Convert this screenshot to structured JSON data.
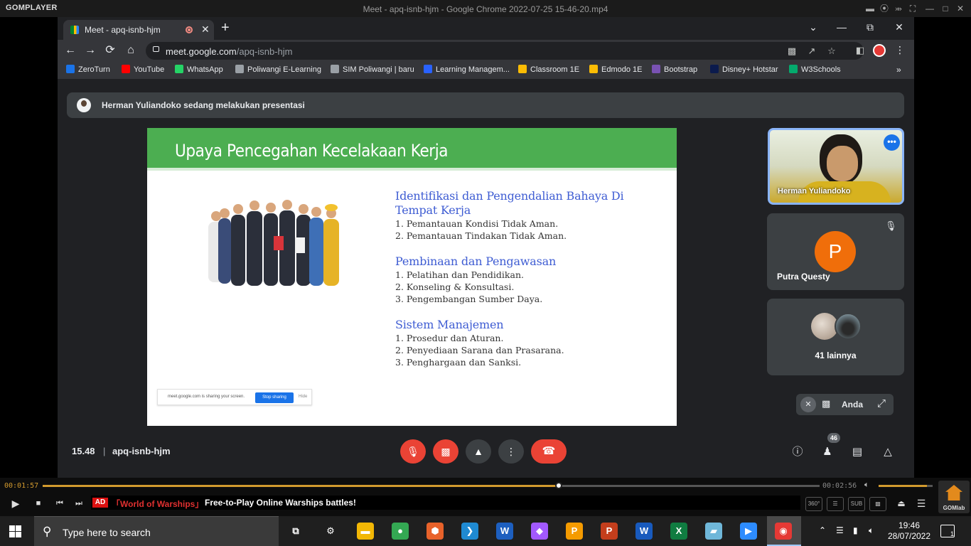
{
  "player": {
    "logo": "GOMPLAYER",
    "title": "Meet - apq-isnb-hjm - Google Chrome 2022-07-25 15-46-20.mp4",
    "time_current": "00:01:57",
    "time_total": "00:02:56",
    "progress": 0.664,
    "volume": 0.9,
    "ad_tag": "AD",
    "ad_title": "「World of Warships」",
    "ad_text": "Free-to-Play Online Warships battles!",
    "btn_360": "360°",
    "btn_sub": "SUB",
    "gomlab_label": "GOMlab"
  },
  "chrome": {
    "tab_title": "Meet - apq-isnb-hjm",
    "url_host": "meet.google.com",
    "url_path": "/apq-isnb-hjm",
    "bookmarks": [
      {
        "label": "ZeroTurn",
        "color": "#1a73e8"
      },
      {
        "label": "YouTube",
        "color": "#ff0000"
      },
      {
        "label": "WhatsApp",
        "color": "#25d366"
      },
      {
        "label": "Poliwangi E-Learning",
        "color": "#9aa0a6"
      },
      {
        "label": "SIM Poliwangi | baru",
        "color": "#9aa0a6"
      },
      {
        "label": "Learning Managem...",
        "color": "#2962ff"
      },
      {
        "label": "Classroom 1E",
        "color": "#fbbc04"
      },
      {
        "label": "Edmodo 1E",
        "color": "#fbbc04"
      },
      {
        "label": "Bootstrap",
        "color": "#7952b3"
      },
      {
        "label": "Disney+ Hotstar",
        "color": "#0b1b4d"
      },
      {
        "label": "W3Schools",
        "color": "#04aa6d"
      }
    ]
  },
  "meet": {
    "presenter_text": "Herman Yuliandoko sedang melakukan presentasi",
    "participants": {
      "herman": "Herman Yuliandoko",
      "putra": "Putra Questy",
      "putra_initial": "P",
      "others": "41 lainnya",
      "self": "Anda"
    },
    "time": "15.48",
    "separator": "|",
    "code": "apq-isnb-hjm",
    "people_count": "46",
    "accent_red": "#ea4335"
  },
  "slide": {
    "title": "Upaya Pencegahan Kecelakaan Kerja",
    "sections": [
      {
        "heading": "Identifikasi dan Pengendalian Bahaya Di Tempat Kerja",
        "items": [
          "1.  Pemantauan Kondisi Tidak Aman.",
          "2.  Pemantauan Tindakan Tidak Aman."
        ]
      },
      {
        "heading": "Pembinaan dan Pengawasan",
        "items": [
          "1.  Pelatihan dan Pendidikan.",
          "2.  Konseling & Konsultasi.",
          "3.  Pengembangan Sumber Daya."
        ]
      },
      {
        "heading": "Sistem Manajemen",
        "items": [
          "1.  Prosedur dan Aturan.",
          "2.  Penyediaan Sarana dan Prasarana.",
          "3.  Penghargaan dan Sanksi."
        ]
      }
    ],
    "share_notice": "meet.google.com is sharing your screen.",
    "stop_sharing": "Stop sharing",
    "hide": "Hide"
  },
  "taskbar": {
    "search_placeholder": "Type here to search",
    "time": "19:46",
    "date": "28/07/2022",
    "notifications": "1",
    "apps": [
      {
        "name": "task-view",
        "glyph": "⧉",
        "color": "transparent"
      },
      {
        "name": "settings",
        "glyph": "⚙",
        "color": "transparent"
      },
      {
        "name": "file-explorer",
        "glyph": "▬",
        "color": "#f2b705"
      },
      {
        "name": "chrome",
        "glyph": "●",
        "color": "#34a853"
      },
      {
        "name": "git-kraken",
        "glyph": "⬢",
        "color": "#e8622a"
      },
      {
        "name": "vscode",
        "glyph": "❯",
        "color": "#1f8ad2"
      },
      {
        "name": "app-blue-w",
        "glyph": "W",
        "color": "#1d5fbf"
      },
      {
        "name": "figma",
        "glyph": "◆",
        "color": "#a259ff"
      },
      {
        "name": "app-orange",
        "glyph": "P",
        "color": "#f59b00"
      },
      {
        "name": "powerpoint",
        "glyph": "P",
        "color": "#c43e1c"
      },
      {
        "name": "word",
        "glyph": "W",
        "color": "#185abd"
      },
      {
        "name": "excel",
        "glyph": "X",
        "color": "#107c41"
      },
      {
        "name": "notes",
        "glyph": "▰",
        "color": "#6fb7d9"
      },
      {
        "name": "zoom",
        "glyph": "▶",
        "color": "#2d8cff"
      },
      {
        "name": "recorder",
        "glyph": "◉",
        "color": "#e53935"
      }
    ]
  }
}
